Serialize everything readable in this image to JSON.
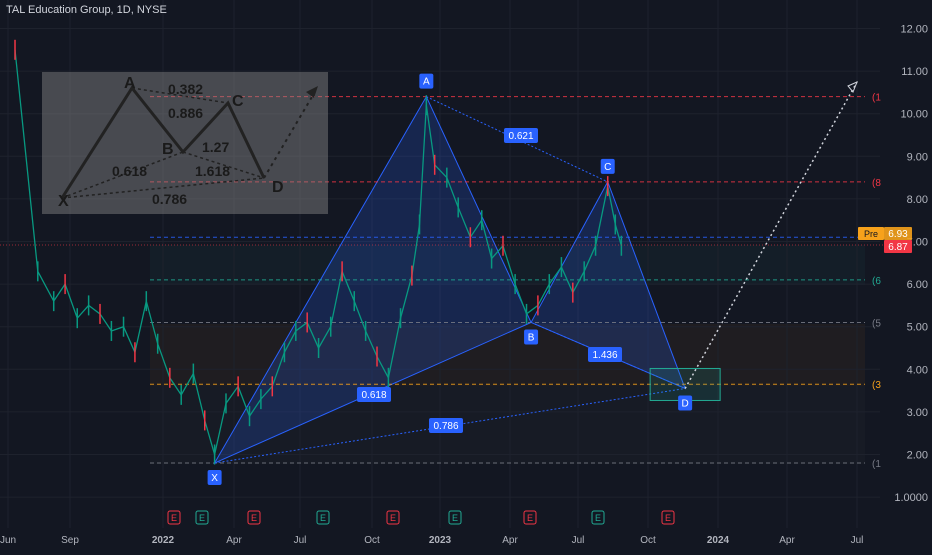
{
  "header": {
    "title": "TAL Education Group, 1D, NYSE"
  },
  "chart_data": {
    "type": "line",
    "y_ticks": [
      "12.00",
      "11.00",
      "10.00",
      "9.00",
      "8.00",
      "7.00",
      "6.00",
      "5.00",
      "4.00",
      "3.00",
      "2.00",
      "1.0000"
    ],
    "x_ticks": [
      "Jun",
      "Sep",
      "2022",
      "Apr",
      "Jul",
      "Oct",
      "2023",
      "Apr",
      "Jul",
      "Oct",
      "2024",
      "Apr",
      "Jul"
    ],
    "ylim": [
      1.0,
      12.0
    ],
    "price_badge": {
      "pre_label": "Pre",
      "pre_value": "6.93",
      "last_value": "6.87",
      "pre_color": "#f7a21b",
      "last_color": "#f23645"
    },
    "pattern_points": [
      {
        "label": "X",
        "x": "2022-03-10",
        "y": 1.8
      },
      {
        "label": "A",
        "x": "2022-12-14",
        "y": 10.4
      },
      {
        "label": "B",
        "x": "2023-05-01",
        "y": 5.1
      },
      {
        "label": "C",
        "x": "2023-08-10",
        "y": 8.4
      },
      {
        "label": "D",
        "x": "2023-11-20",
        "y": 3.55
      }
    ],
    "ratios": [
      {
        "label": "0.618"
      },
      {
        "label": "0.621"
      },
      {
        "label": "1.436"
      },
      {
        "label": "0.786"
      }
    ],
    "level_lines": [
      {
        "value": 10.4,
        "label": "(1",
        "color": "#f23645"
      },
      {
        "value": 8.4,
        "label": "(8",
        "color": "#f23645"
      },
      {
        "value": 7.1,
        "label": "",
        "color": "#2962ff"
      },
      {
        "value": 6.1,
        "label": "(6",
        "color": "#22ab94"
      },
      {
        "value": 5.1,
        "label": "(5",
        "color": "#787b86"
      },
      {
        "value": 3.65,
        "label": "(3",
        "color": "#f7a21b"
      },
      {
        "value": 1.8,
        "label": "(1",
        "color": "#787b86"
      }
    ],
    "earnings_markers": [
      "E",
      "E",
      "E",
      "E",
      "E",
      "E",
      "E",
      "E",
      "E"
    ],
    "inset": {
      "labels": [
        "A",
        "C",
        "B",
        "X",
        "D"
      ],
      "ratios": [
        "0.382",
        "0.886",
        "1.27",
        "0.618",
        "1.618",
        "0.786"
      ]
    },
    "candles": [
      {
        "x": "2021-06-20",
        "y": 13.5
      },
      {
        "x": "2021-07-20",
        "y": 6.3
      },
      {
        "x": "2021-08-10",
        "y": 5.6
      },
      {
        "x": "2021-08-25",
        "y": 6.0
      },
      {
        "x": "2021-09-10",
        "y": 5.2
      },
      {
        "x": "2021-09-25",
        "y": 5.5
      },
      {
        "x": "2021-10-10",
        "y": 5.3
      },
      {
        "x": "2021-10-25",
        "y": 4.9
      },
      {
        "x": "2021-11-10",
        "y": 5.0
      },
      {
        "x": "2021-11-25",
        "y": 4.4
      },
      {
        "x": "2021-12-10",
        "y": 5.6
      },
      {
        "x": "2021-12-25",
        "y": 4.6
      },
      {
        "x": "2022-01-10",
        "y": 3.8
      },
      {
        "x": "2022-01-25",
        "y": 3.4
      },
      {
        "x": "2022-02-10",
        "y": 3.9
      },
      {
        "x": "2022-02-25",
        "y": 2.8
      },
      {
        "x": "2022-03-10",
        "y": 2.0
      },
      {
        "x": "2022-03-25",
        "y": 3.2
      },
      {
        "x": "2022-04-10",
        "y": 3.6
      },
      {
        "x": "2022-04-25",
        "y": 2.9
      },
      {
        "x": "2022-05-10",
        "y": 3.3
      },
      {
        "x": "2022-05-25",
        "y": 3.6
      },
      {
        "x": "2022-06-10",
        "y": 4.4
      },
      {
        "x": "2022-06-25",
        "y": 4.9
      },
      {
        "x": "2022-07-10",
        "y": 5.1
      },
      {
        "x": "2022-07-25",
        "y": 4.5
      },
      {
        "x": "2022-08-10",
        "y": 5.0
      },
      {
        "x": "2022-08-25",
        "y": 6.3
      },
      {
        "x": "2022-09-10",
        "y": 5.6
      },
      {
        "x": "2022-09-25",
        "y": 4.9
      },
      {
        "x": "2022-10-10",
        "y": 4.3
      },
      {
        "x": "2022-10-25",
        "y": 3.8
      },
      {
        "x": "2022-11-10",
        "y": 5.2
      },
      {
        "x": "2022-11-25",
        "y": 6.2
      },
      {
        "x": "2022-12-05",
        "y": 7.4
      },
      {
        "x": "2022-12-14",
        "y": 10.2
      },
      {
        "x": "2022-12-25",
        "y": 8.8
      },
      {
        "x": "2023-01-10",
        "y": 8.5
      },
      {
        "x": "2023-01-25",
        "y": 7.8
      },
      {
        "x": "2023-02-10",
        "y": 7.1
      },
      {
        "x": "2023-02-25",
        "y": 7.5
      },
      {
        "x": "2023-03-10",
        "y": 6.6
      },
      {
        "x": "2023-03-25",
        "y": 6.9
      },
      {
        "x": "2023-04-10",
        "y": 6.0
      },
      {
        "x": "2023-04-25",
        "y": 5.3
      },
      {
        "x": "2023-05-10",
        "y": 5.5
      },
      {
        "x": "2023-05-25",
        "y": 6.0
      },
      {
        "x": "2023-06-10",
        "y": 6.4
      },
      {
        "x": "2023-06-25",
        "y": 5.8
      },
      {
        "x": "2023-07-10",
        "y": 6.3
      },
      {
        "x": "2023-07-25",
        "y": 6.9
      },
      {
        "x": "2023-08-10",
        "y": 8.3
      },
      {
        "x": "2023-08-20",
        "y": 7.4
      },
      {
        "x": "2023-08-28",
        "y": 6.9
      }
    ]
  }
}
